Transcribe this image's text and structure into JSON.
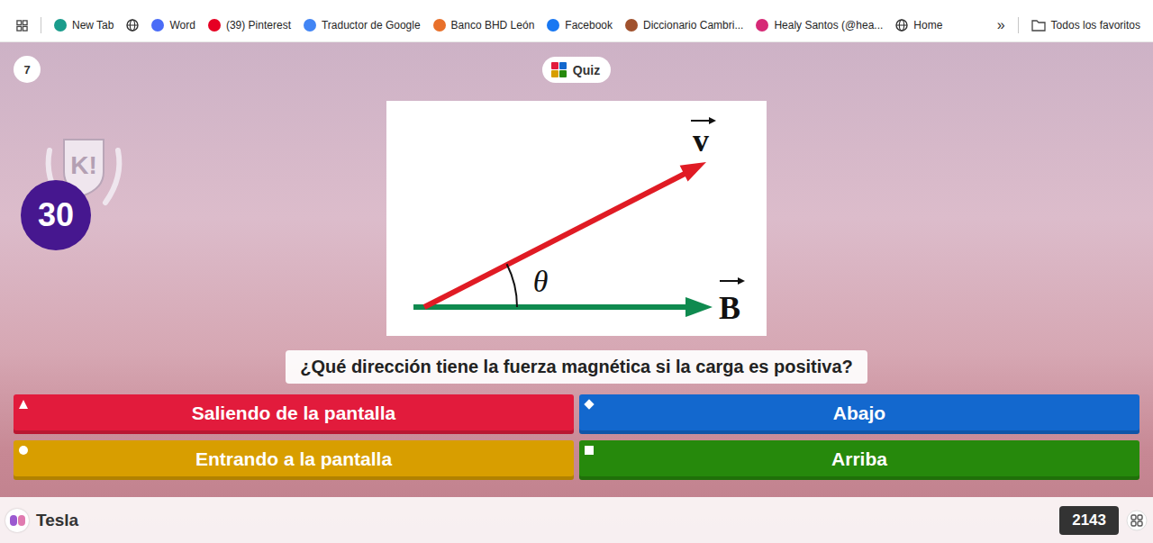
{
  "browser": {
    "bookmarks": [
      {
        "label": "New Tab",
        "kind": "favicon",
        "color": "#1a9c8c"
      },
      {
        "kind": "globe"
      },
      {
        "label": "Word",
        "kind": "favicon",
        "color": "#4a6cf7"
      },
      {
        "label": "(39) Pinterest",
        "kind": "favicon",
        "color": "#e60023"
      },
      {
        "label": "Traductor de Google",
        "kind": "favicon",
        "color": "#4285f4"
      },
      {
        "label": "Banco BHD León",
        "kind": "favicon",
        "color": "#e8702a"
      },
      {
        "label": "Facebook",
        "kind": "favicon",
        "color": "#1877f2"
      },
      {
        "label": "Diccionario Cambri...",
        "kind": "favicon",
        "color": "#a0512d"
      },
      {
        "label": "Healy Santos (@hea...",
        "kind": "favicon",
        "color": "#d62976"
      },
      {
        "label": "Home",
        "kind": "globe"
      }
    ],
    "more": "»",
    "all_bookmarks": "Todos los favoritos"
  },
  "quiz": {
    "question_number": "7",
    "type": "Quiz",
    "logo": "K!",
    "timer": "30",
    "figure": {
      "vectors": [
        {
          "label": "v",
          "color": "#e01b24"
        },
        {
          "label": "B",
          "color": "#0f8a4f"
        }
      ],
      "angle": "θ"
    },
    "question": "¿Qué dirección tiene la fuerza magnética si la carga es positiva?",
    "answers": [
      {
        "text": "Saliendo de la pantalla",
        "kind": "triangle",
        "color": "#e21b3c"
      },
      {
        "text": "Abajo",
        "kind": "diamond",
        "color": "#1368ce"
      },
      {
        "text": "Entrando a la pantalla",
        "kind": "circle",
        "color": "#d89e00"
      },
      {
        "text": "Arriba",
        "kind": "square",
        "color": "#26890c"
      }
    ],
    "player": "Tesla",
    "score": "2143"
  }
}
